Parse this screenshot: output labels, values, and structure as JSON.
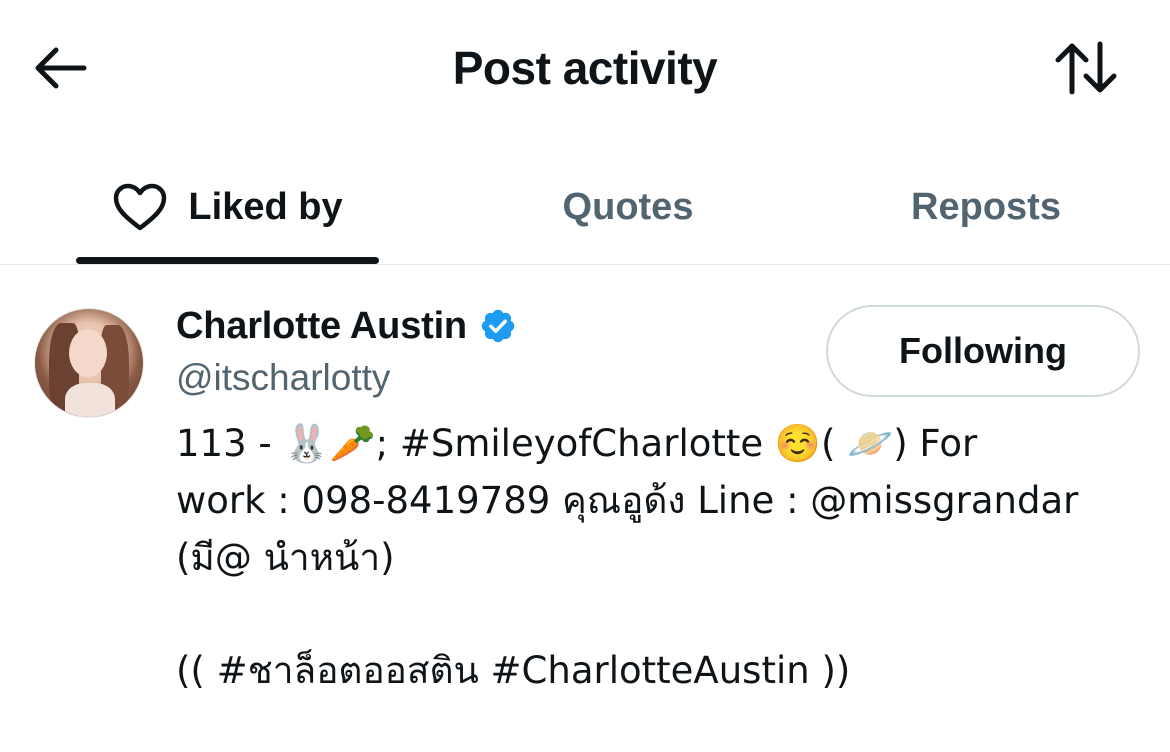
{
  "header": {
    "title": "Post activity",
    "back_icon": "arrow-left-icon",
    "sort_icon": "sort-arrows-icon"
  },
  "tabs": [
    {
      "label": "Liked by",
      "icon": "heart-icon",
      "active": true
    },
    {
      "label": "Quotes",
      "active": false
    },
    {
      "label": "Reposts",
      "active": false
    }
  ],
  "user": {
    "display_name": "Charlotte Austin",
    "verified": true,
    "handle": "@itscharlotty",
    "follow_button_label": "Following",
    "bio_lines": [
      "113 - 🐰🥕; #SmileyofCharlotte ☺️( 🪐) For",
      "work : 098-8419789 คุณอูด้ง Line : @missgrandar",
      "(มี@ นำหน้า)",
      "(( #ชาล็อตออสติน #CharlotteAustin ))"
    ]
  },
  "colors": {
    "text_primary": "#0f1419",
    "text_secondary": "#536471",
    "verified_blue": "#1d9bf0",
    "border": "#cfd9de",
    "divider": "#e7e9ea"
  }
}
